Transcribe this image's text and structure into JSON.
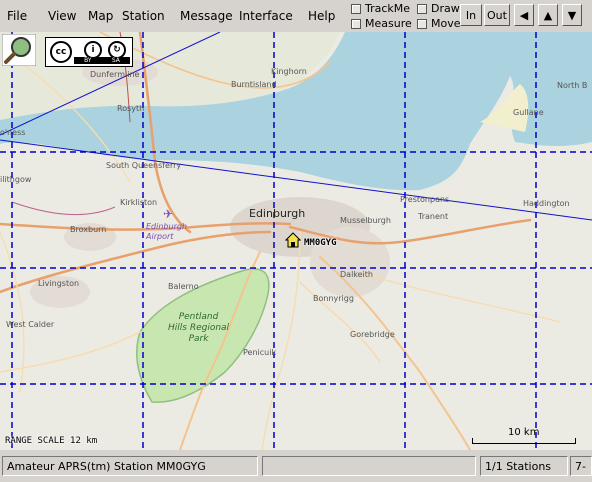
{
  "menu": {
    "items": [
      "File",
      "View",
      "Map",
      "Station",
      "Message",
      "Interface",
      "Help"
    ]
  },
  "toolbar": {
    "trackme_label": "TrackMe",
    "draw_label": "Draw",
    "measure_label": "Measure",
    "move_label": "Move",
    "zoom_in_label": "In",
    "zoom_out_label": "Out",
    "pan_left_label": "◀",
    "pan_up_label": "▲",
    "pan_down_label": "▼"
  },
  "map": {
    "license_badge": {
      "by": "BY",
      "sa": "SA",
      "cc": "cc"
    },
    "station_callsign": "MM0GYG",
    "range_scale": "RANGE SCALE 12 km",
    "scale_bar": "10 km",
    "places": {
      "edinburgh": "Edinburgh",
      "dunfermline": "Dunfermline",
      "rosyth": "Rosyth",
      "burntisland": "Burntisland",
      "kinghorn": "Kinghorn",
      "south_queensferry": "South Queensferry",
      "kirkliston": "Kirkliston",
      "broxburn": "Broxburn",
      "livingston": "Livingston",
      "west_calder": "West Calder",
      "balerno": "Balerno",
      "penicuik": "Penicuik",
      "musselburgh": "Musselburgh",
      "dalkeith": "Dalkeith",
      "bonnyrigg": "Bonnyrigg",
      "gorebridge": "Gorebridge",
      "prestonpans": "Prestonpans",
      "tranent": "Tranent",
      "haddington": "Haddington",
      "gullane": "Gullane",
      "north_berwick": "North B",
      "linlithgow": "ilithgow",
      "bo_ness": "o'ness",
      "airport": "Edinburgh\nAirport",
      "pentland": "Pentland\nHills Regional\nPark"
    }
  },
  "statusbar": {
    "message": "Amateur APRS(tm) Station MM0GYG",
    "stations": "1/1 Stations",
    "extra": "7-"
  },
  "colors": {
    "sea": "#aad3df",
    "park": "#c8e6b0",
    "grid": "#0000cc",
    "chrome": "#d6d3ce"
  }
}
